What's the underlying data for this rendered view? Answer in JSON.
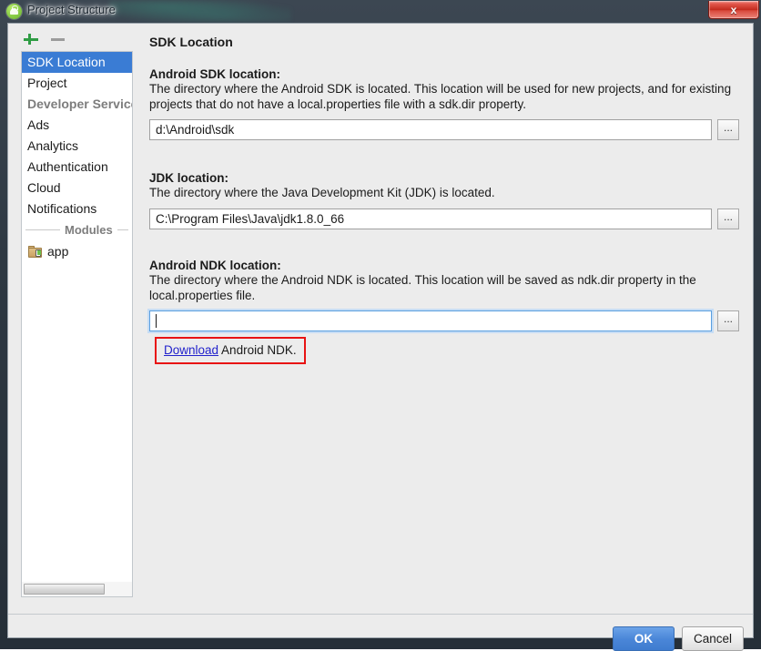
{
  "window": {
    "title": "Project Structure",
    "app_icon": "android-studio-icon",
    "close_label": "x"
  },
  "sidebar": {
    "toolbar": {
      "add_icon": "plus-icon",
      "remove_icon": "minus-icon"
    },
    "items": [
      {
        "label": "SDK Location",
        "type": "item",
        "selected": true
      },
      {
        "label": "Project",
        "type": "item",
        "selected": false
      },
      {
        "label": "Developer Services",
        "type": "group",
        "selected": false
      },
      {
        "label": "Ads",
        "type": "item",
        "selected": false
      },
      {
        "label": "Analytics",
        "type": "item",
        "selected": false
      },
      {
        "label": "Authentication",
        "type": "item",
        "selected": false
      },
      {
        "label": "Cloud",
        "type": "item",
        "selected": false
      },
      {
        "label": "Notifications",
        "type": "item",
        "selected": false
      }
    ],
    "modules_separator": "Modules",
    "modules": [
      {
        "label": "app",
        "icon": "android-module-folder-icon"
      }
    ]
  },
  "main": {
    "title": "SDK Location",
    "sections": [
      {
        "label": "Android SDK location:",
        "description": "The directory where the Android SDK is located. This location will be used for new projects, and for existing projects that do not have a local.properties file with a sdk.dir property.",
        "value": "d:\\Android\\sdk",
        "placeholder": "",
        "browse_label": "...",
        "focused": false
      },
      {
        "label": "JDK location:",
        "description": "The directory where the Java Development Kit (JDK) is located.",
        "value": "C:\\Program Files\\Java\\jdk1.8.0_66",
        "placeholder": "",
        "browse_label": "...",
        "focused": false
      },
      {
        "label": "Android NDK location:",
        "description": "The directory where the Android NDK is located. This location will be saved as ndk.dir property in the local.properties file.",
        "value": "",
        "placeholder": "",
        "browse_label": "...",
        "focused": true
      }
    ],
    "ndk_link": {
      "link_text": "Download",
      "tail_text": " Android NDK.",
      "highlight_color": "#e81313"
    }
  },
  "footer": {
    "ok_label": "OK",
    "cancel_label": "Cancel"
  },
  "colors": {
    "selection_blue": "#3a7cd4",
    "link_blue": "#2222cc",
    "annotation_red": "#e81313",
    "ok_blue": "#4a86d8"
  }
}
